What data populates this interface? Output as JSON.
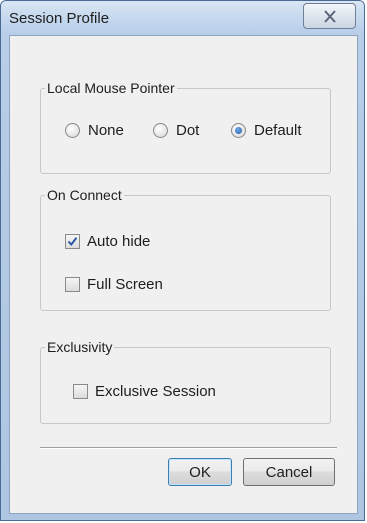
{
  "window": {
    "title": "Session Profile",
    "close_icon": "close-icon"
  },
  "groups": {
    "pointer": {
      "label": "Local Mouse Pointer",
      "options": [
        {
          "label": "None",
          "checked": false
        },
        {
          "label": "Dot",
          "checked": false
        },
        {
          "label": "Default",
          "checked": true
        }
      ]
    },
    "on_connect": {
      "label": "On Connect",
      "options": [
        {
          "label": "Auto hide",
          "checked": true
        },
        {
          "label": "Full Screen",
          "checked": false
        }
      ]
    },
    "exclusivity": {
      "label": "Exclusivity",
      "options": [
        {
          "label": "Exclusive Session",
          "checked": false
        }
      ]
    }
  },
  "buttons": {
    "ok": "OK",
    "cancel": "Cancel"
  },
  "colors": {
    "title_bar": "#c5d8ee",
    "dialog_background": "#f0f0f0",
    "radio_selected": "#1f5fa8",
    "checkmark": "#2b59a8"
  }
}
